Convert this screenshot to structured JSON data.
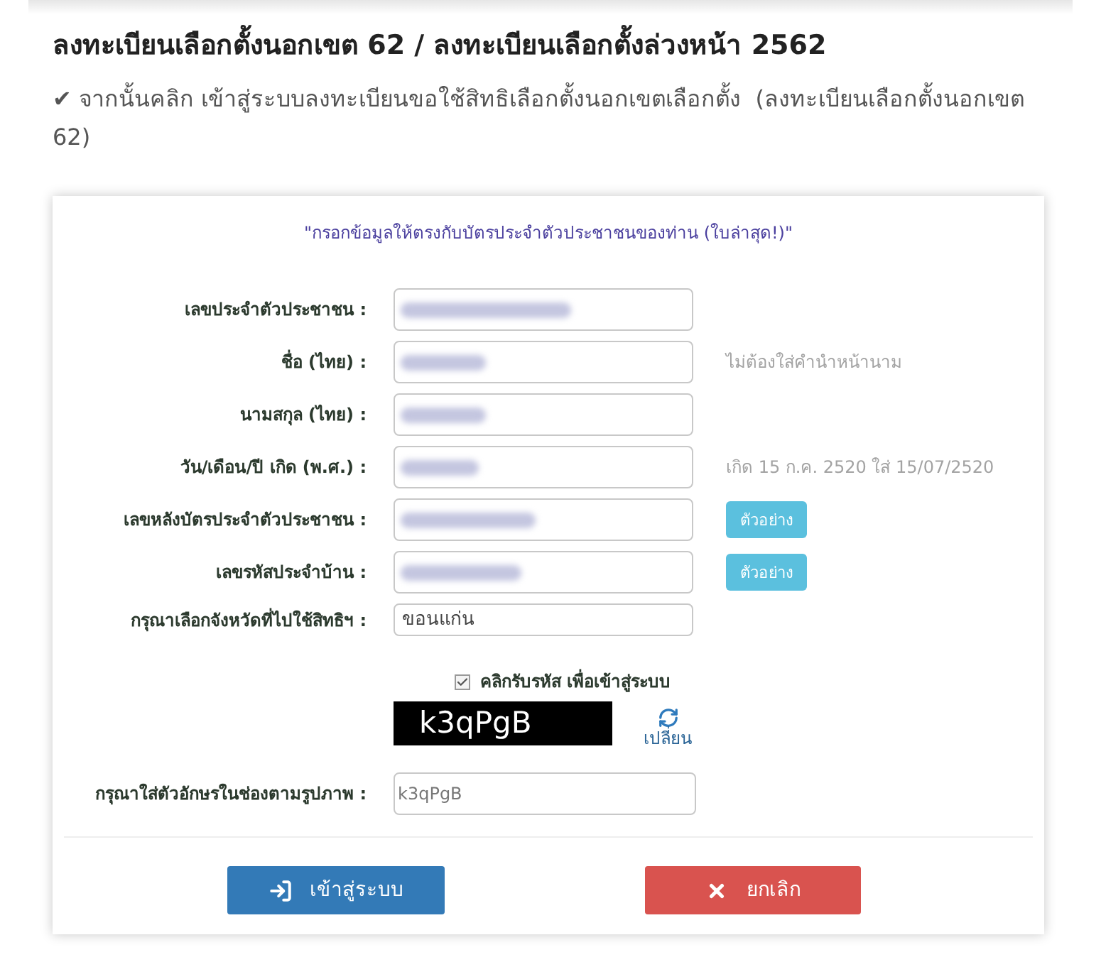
{
  "article": {
    "heading": "ลงทะเบียนเลือกตั้งนอกเขต 62 / ลงทะเบียนเลือกตั้งล่วงหน้า 2562",
    "paragraph": "✔ จากนั้นคลิก เข้าสู่ระบบลงทะเบียนขอใช้สิทธิเลือกตั้งนอกเขตเลือกตั้ง  (ลงทะเบียนเลือกตั้งนอกเขต 62)"
  },
  "form": {
    "notice": "\"กรอกข้อมูลให้ตรงกับบัตรประจำตัวประชาชนของท่าน (ใบล่าสุด!)\"",
    "fields": [
      {
        "kind": "text",
        "label": "เลขประจำตัวประชาชน :",
        "blurred": true
      },
      {
        "kind": "text",
        "label": "ชื่อ (ไทย) :",
        "blurred": true,
        "hint": "ไม่ต้องใส่คำนำหน้านาม"
      },
      {
        "kind": "text",
        "label": "นามสกุล (ไทย) :",
        "blurred": true
      },
      {
        "kind": "text",
        "label": "วัน/เดือน/ปี เกิด (พ.ศ.) :",
        "blurred": true,
        "hint": "เกิด 15 ก.ค. 2520 ใส่ 15/07/2520"
      },
      {
        "kind": "text",
        "label": "เลขหลังบัตรประจำตัวประชาชน :",
        "blurred": true,
        "button": "ตัวอย่าง"
      },
      {
        "kind": "text",
        "label": "เลขรหัสประจำบ้าน :",
        "blurred": true,
        "button": "ตัวอย่าง"
      },
      {
        "kind": "select",
        "label": "กรุณาเลือกจังหวัดที่ไปใช้สิทธิฯ :",
        "value": "ขอนแก่น"
      }
    ],
    "captcha": {
      "checkbox_label": "คลิกรับรหัส เพื่อเข้าสู่ระบบ",
      "checked": true,
      "code": "k3qPgB",
      "refresh_label": "เปลี่ยน",
      "input_label": "กรุณาใส่ตัวอักษรในช่องตามรูปภาพ :",
      "input_value": "k3qPgB"
    },
    "buttons": [
      {
        "kind": "login",
        "label": "เข้าสู่ระบบ"
      },
      {
        "kind": "cancel",
        "label": "ยกเลิก"
      }
    ]
  }
}
